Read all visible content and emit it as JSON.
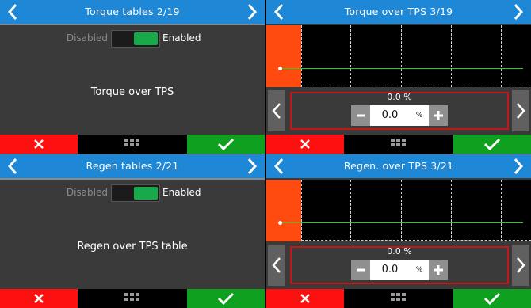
{
  "panels": [
    {
      "title": "Torque tables 2/19",
      "toggle": {
        "disabled_label": "Disabled",
        "enabled_label": "Enabled",
        "state": "enabled"
      },
      "description": "Torque over TPS"
    },
    {
      "title": "Torque over TPS 3/19",
      "value_display": "0.0 %",
      "stepper": {
        "value": "0.0",
        "unit": "%"
      }
    },
    {
      "title": "Regen tables 2/21",
      "toggle": {
        "disabled_label": "Disabled",
        "enabled_label": "Enabled",
        "state": "enabled"
      },
      "description": "Regen over TPS table"
    },
    {
      "title": "Regen. over TPS 3/21",
      "value_display": "0.0 %",
      "stepper": {
        "value": "0.0",
        "unit": "%"
      }
    }
  ],
  "icons": {
    "back": "chevron-left-icon",
    "forward": "chevron-right-icon",
    "cancel": "close-icon",
    "menu": "grid-icon",
    "confirm": "check-icon",
    "decrement": "minus-icon",
    "increment": "plus-icon"
  },
  "colors": {
    "header": "#1e88d6",
    "cancel": "#ff1010",
    "confirm": "#10a020",
    "switch_on": "#17a94a",
    "graph_marker": "#ff4a10",
    "graph_line": "#22d022",
    "selection_border": "#c01818"
  }
}
